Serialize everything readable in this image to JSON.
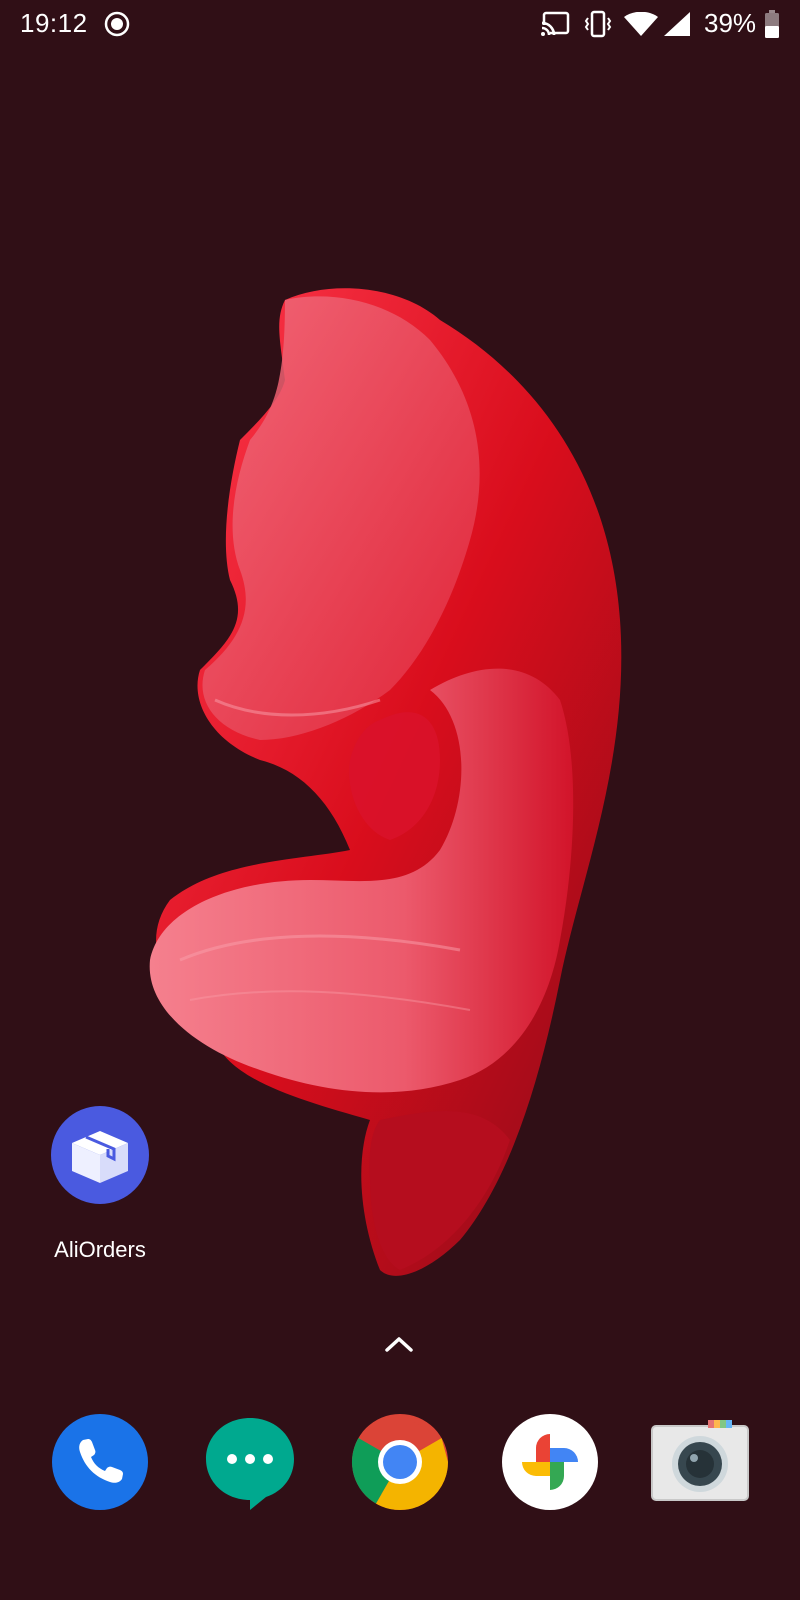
{
  "status_bar": {
    "time": "19:12",
    "battery_percent": "39%",
    "icons": [
      "screen-record-icon",
      "cast-icon",
      "vibrate-icon",
      "wifi-icon",
      "cell-signal-icon",
      "battery-icon"
    ]
  },
  "home": {
    "apps": [
      {
        "label": "AliOrders",
        "icon": "package-box-icon",
        "color": "#4a5ae0"
      }
    ],
    "swipe_hint_icon": "chevron-up-icon"
  },
  "dock": [
    {
      "icon": "phone-icon",
      "color": "#1a73e8"
    },
    {
      "icon": "messages-icon",
      "color": "#00a98f"
    },
    {
      "icon": "chrome-icon",
      "color": "#db4437"
    },
    {
      "icon": "photos-icon",
      "color": "#ffffff"
    },
    {
      "icon": "camera-icon",
      "color": "#e8e8e8"
    }
  ],
  "colors": {
    "background": "#300f16",
    "wallpaper_red": "#e0101e",
    "wallpaper_pink": "#f07a8a"
  }
}
